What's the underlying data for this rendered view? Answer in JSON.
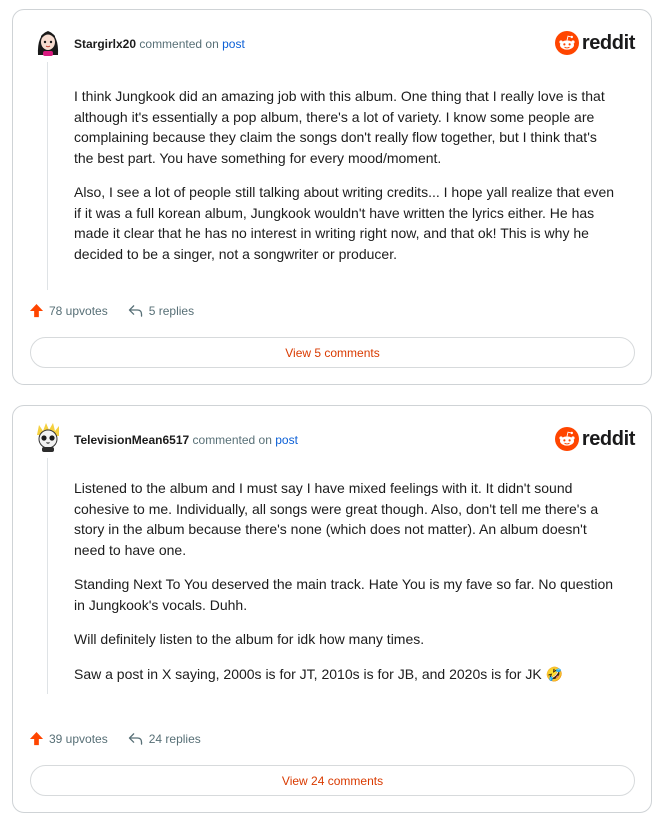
{
  "brand": {
    "wordmark": "reddit",
    "accent": "#ff4500"
  },
  "comments": [
    {
      "username": "Stargirlx20",
      "commented_text": "commented on",
      "post_link": "post",
      "paragraphs": [
        "I think Jungkook did an amazing job with this album. One thing that I really love is that although it's essentially a pop album, there's a lot of variety. I know some people are complaining because they claim the songs don't really flow together, but I think that's the best part. You have something for every mood/moment.",
        "Also, I see a lot of people still talking about writing credits... I hope yall realize that even if it was a full korean album, Jungkook wouldn't have written the lyrics either. He has made it clear that he has no interest in writing right now, and that ok! This is why he decided to be a singer, not a songwriter or producer."
      ],
      "upvotes": "78 upvotes",
      "replies": "5 replies",
      "view_button": "View 5 comments"
    },
    {
      "username": "TelevisionMean6517",
      "commented_text": "commented on",
      "post_link": "post",
      "paragraphs": [
        "Listened to the album and I must say I have mixed feelings with it. It didn't sound cohesive to me. Individually, all songs were great though. Also, don't tell me there's a story in the album because there's none (which does not matter). An album doesn't need to have one.",
        "Standing Next To You deserved the main track. Hate You is my fave so far. No question in Jungkook's vocals. Duhh.",
        "Will definitely listen to the album for idk how many times.",
        "Saw a post in X saying, 2000s is for JT, 2010s is for JB, and 2020s is for JK 🤣"
      ],
      "upvotes": "39 upvotes",
      "replies": "24 replies",
      "view_button": "View 24 comments"
    }
  ]
}
